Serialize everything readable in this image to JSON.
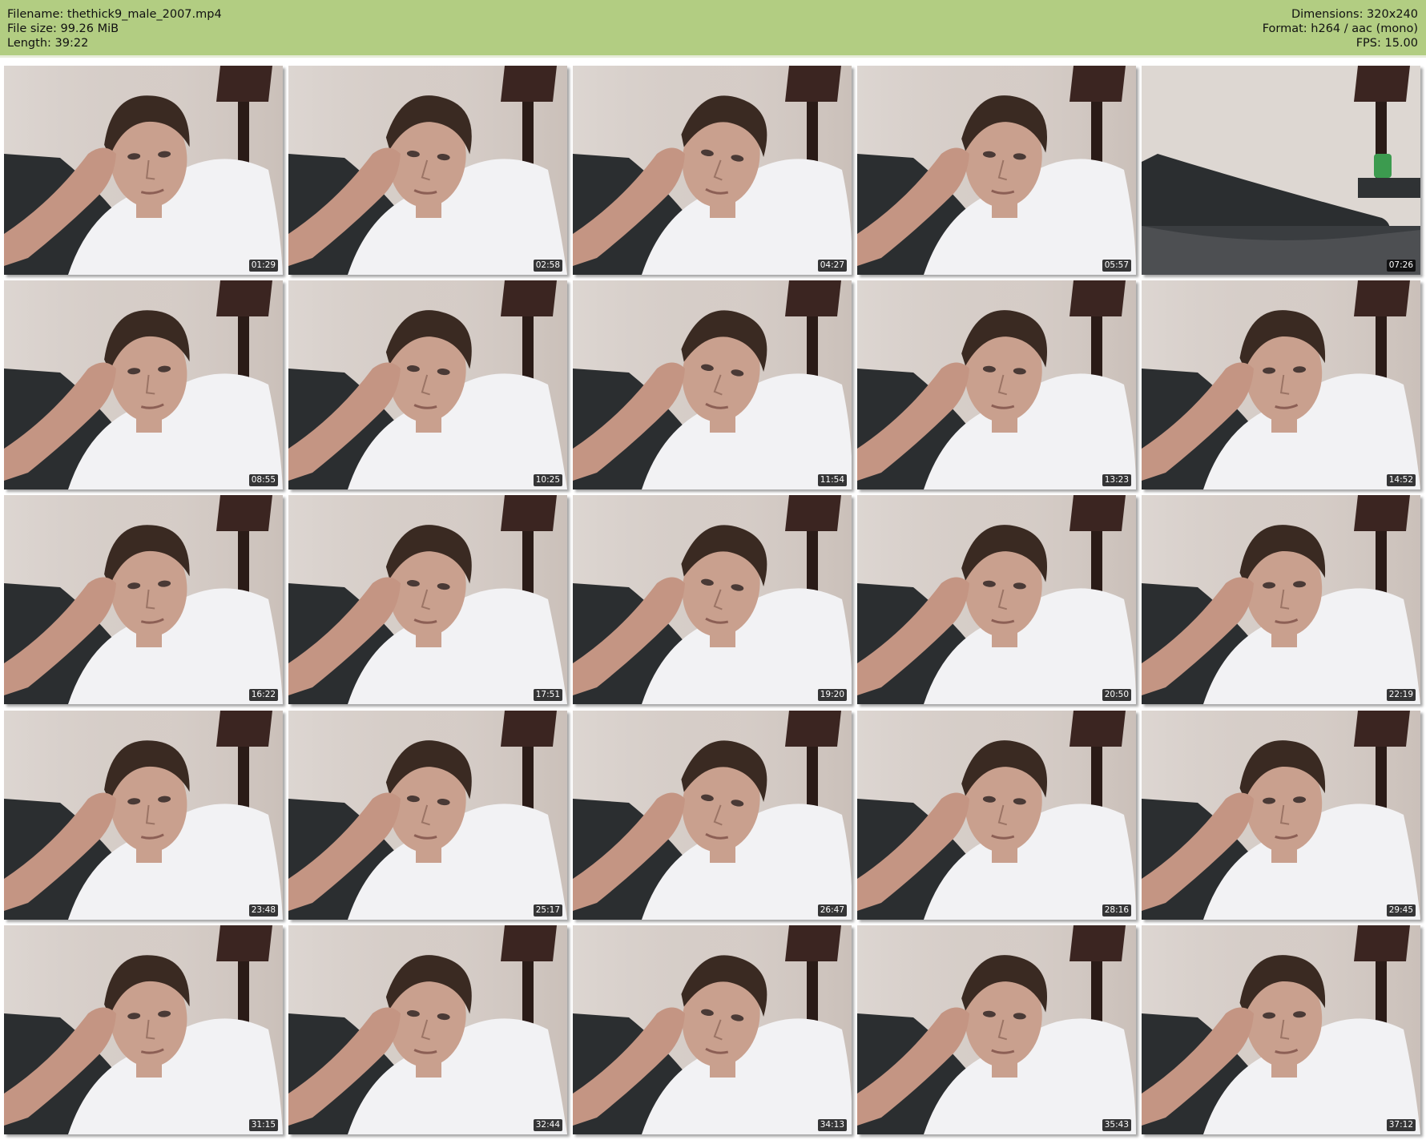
{
  "header": {
    "filename": "Filename: thethick9_male_2007.mp4",
    "file_size": "File size: 99.26 MiB",
    "length": "Length: 39:22",
    "dimensions": "Dimensions: 320x240",
    "format": "Format: h264 / aac (mono)",
    "fps": "FPS: 15.00"
  },
  "colors": {
    "header_bg": "#b2cd82",
    "wall": "#d8d0cb",
    "couch": "#2b2e30",
    "shirt": "#f2f2f4",
    "skin": "#c9a08e",
    "hair": "#3a2a22",
    "lamp": "#3b2521"
  },
  "thumbnails": [
    {
      "time": "01:29",
      "scene": "person-icon"
    },
    {
      "time": "02:58",
      "scene": "person-icon"
    },
    {
      "time": "04:27",
      "scene": "person-icon"
    },
    {
      "time": "05:57",
      "scene": "person-icon"
    },
    {
      "time": "07:26",
      "scene": "empty-couch-icon"
    },
    {
      "time": "08:55",
      "scene": "person-icon"
    },
    {
      "time": "10:25",
      "scene": "person-icon"
    },
    {
      "time": "11:54",
      "scene": "person-icon"
    },
    {
      "time": "13:23",
      "scene": "person-icon"
    },
    {
      "time": "14:52",
      "scene": "person-icon"
    },
    {
      "time": "16:22",
      "scene": "person-icon"
    },
    {
      "time": "17:51",
      "scene": "person-icon"
    },
    {
      "time": "19:20",
      "scene": "person-icon"
    },
    {
      "time": "20:50",
      "scene": "person-icon"
    },
    {
      "time": "22:19",
      "scene": "person-icon"
    },
    {
      "time": "23:48",
      "scene": "person-icon"
    },
    {
      "time": "25:17",
      "scene": "person-icon"
    },
    {
      "time": "26:47",
      "scene": "person-icon"
    },
    {
      "time": "28:16",
      "scene": "person-icon"
    },
    {
      "time": "29:45",
      "scene": "person-icon"
    },
    {
      "time": "31:15",
      "scene": "person-icon"
    },
    {
      "time": "32:44",
      "scene": "person-icon"
    },
    {
      "time": "34:13",
      "scene": "person-icon"
    },
    {
      "time": "35:43",
      "scene": "person-icon"
    },
    {
      "time": "37:12",
      "scene": "person-icon"
    }
  ]
}
